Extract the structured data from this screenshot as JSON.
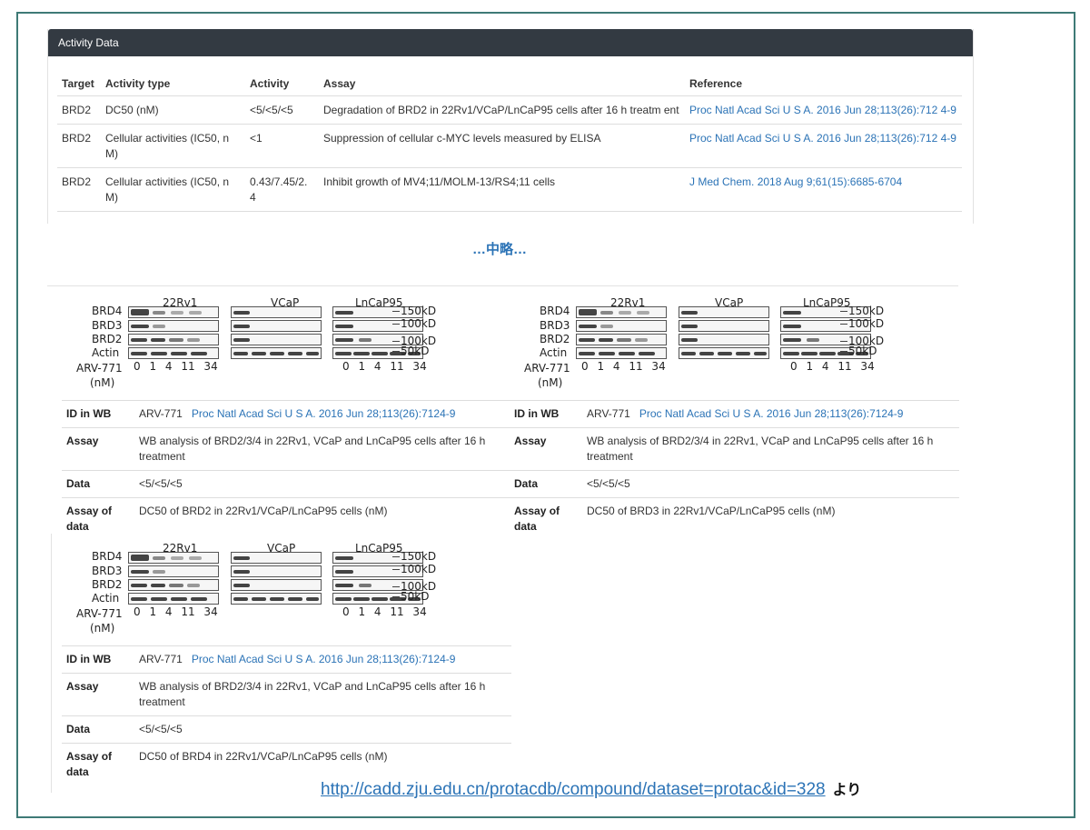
{
  "activity_panel": {
    "title": "Activity Data",
    "columns": [
      "Target",
      "Activity type",
      "Activity",
      "Assay",
      "Reference"
    ],
    "rows": [
      {
        "target": "BRD2",
        "activity_type": "DC50 (nM)",
        "activity": "<5/<5/<5",
        "assay": "Degradation of BRD2 in 22Rv1/VCaP/LnCaP95 cells after 16 h treatm ent",
        "reference": "Proc Natl Acad Sci U S A. 2016 Jun 28;113(26):712 4-9"
      },
      {
        "target": "BRD2",
        "activity_type": "Cellular activities (IC50, n M)",
        "activity": "<1",
        "assay": "Suppression of cellular c-MYC levels measured by ELISA",
        "reference": "Proc Natl Acad Sci U S A. 2016 Jun 28;113(26):712 4-9"
      },
      {
        "target": "BRD2",
        "activity_type": "Cellular activities (IC50, n M)",
        "activity": "0.43/7.45/2. 4",
        "assay": "Inhibit growth of MV4;11/MOLM-13/RS4;11 cells",
        "reference": "J Med Chem. 2018 Aug 9;61(15):6685-6704"
      }
    ]
  },
  "omission": "…中略…",
  "blot": {
    "cell_lines": [
      "22Rv1",
      "VCaP",
      "LnCaP95"
    ],
    "proteins": [
      "BRD4",
      "BRD3",
      "BRD2",
      "Actin"
    ],
    "compound_label": "ARV-771",
    "unit_label": "(nM)",
    "doses": "0 1 4 11 34",
    "markers": [
      "150kD",
      "100kD",
      "100kD",
      "50kD"
    ]
  },
  "cards": [
    {
      "id_label": "ID in WB",
      "id_value": "ARV-771",
      "ref": "Proc Natl Acad Sci U S A. 2016 Jun 28;113(26):7124-9",
      "assay_label": "Assay",
      "assay": "WB analysis of BRD2/3/4 in 22Rv1, VCaP and LnCaP95 cells after 16 h treatment",
      "data_label": "Data",
      "data": "<5/<5/<5",
      "assay_of_data_label": "Assay of data",
      "assay_of_data": "DC50 of BRD2 in 22Rv1/VCaP/LnCaP95 cells (nM)"
    },
    {
      "id_label": "ID in WB",
      "id_value": "ARV-771",
      "ref": "Proc Natl Acad Sci U S A. 2016 Jun 28;113(26):7124-9",
      "assay_label": "Assay",
      "assay": "WB analysis of BRD2/3/4 in 22Rv1, VCaP and LnCaP95 cells after 16 h treatment",
      "data_label": "Data",
      "data": "<5/<5/<5",
      "assay_of_data_label": "Assay of data",
      "assay_of_data": "DC50 of BRD3 in 22Rv1/VCaP/LnCaP95 cells (nM)"
    },
    {
      "id_label": "ID in WB",
      "id_value": "ARV-771",
      "ref": "Proc Natl Acad Sci U S A. 2016 Jun 28;113(26):7124-9",
      "assay_label": "Assay",
      "assay": "WB analysis of BRD2/3/4 in 22Rv1, VCaP and LnCaP95 cells after 16 h treatment",
      "data_label": "Data",
      "data": "<5/<5/<5",
      "assay_of_data_label": "Assay of data",
      "assay_of_data": "DC50 of BRD4 in 22Rv1/VCaP/LnCaP95 cells (nM)"
    }
  ],
  "source": {
    "url": "http://cadd.zju.edu.cn/protacdb/compound/dataset=protac&id=328",
    "suffix": "より"
  }
}
